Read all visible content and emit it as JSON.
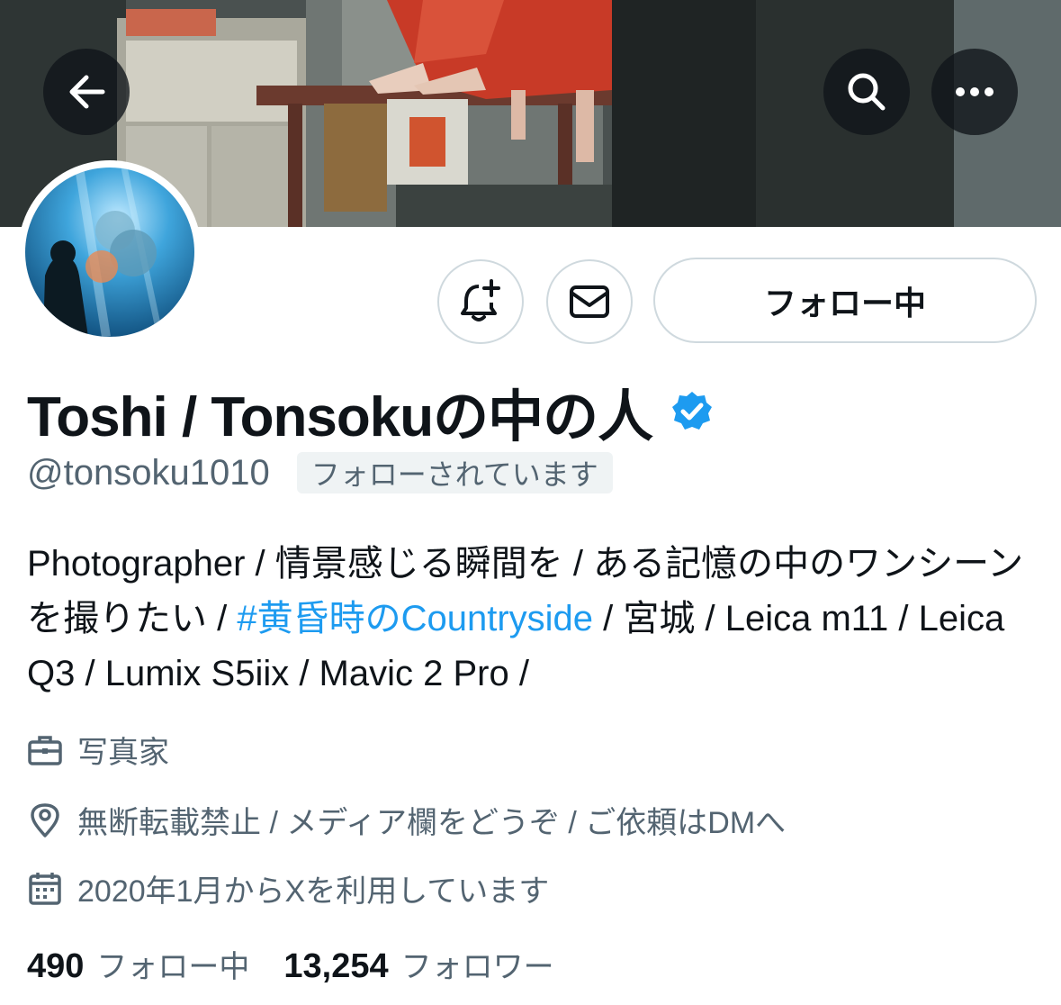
{
  "header": {
    "back_icon": "arrow-left-icon",
    "search_icon": "search-icon",
    "more_icon": "ellipsis-icon"
  },
  "actions": {
    "notify_icon": "bell-plus-icon",
    "dm_icon": "envelope-icon",
    "follow_label": "フォロー中"
  },
  "profile": {
    "display_name": "Toshi / Tonsokuの中の人",
    "verified": true,
    "handle": "@tonsoku1010",
    "follows_you": "フォローされています",
    "bio_part1": "Photographer / 情景感じる瞬間を / ある記憶の中のワンシーンを撮りたい / ",
    "bio_hashtag": "#黄昏時のCountryside",
    "bio_part2": " / 宮城 / Leica m11 / Leica Q3 / Lumix S5iix / Mavic 2 Pro /",
    "job": "写真家",
    "location": "無断転載禁止 / メディア欄をどうぞ / ご依頼はDMへ",
    "joined": "2020年1月からXを利用しています"
  },
  "stats": {
    "following_count": "490",
    "following_label": "フォロー中",
    "followers_count": "13,254",
    "followers_label": "フォロワー"
  },
  "colors": {
    "link": "#1d9bf0",
    "secondary_text": "#536471",
    "border": "#cfd9de",
    "verified": "#1d9bf0"
  }
}
